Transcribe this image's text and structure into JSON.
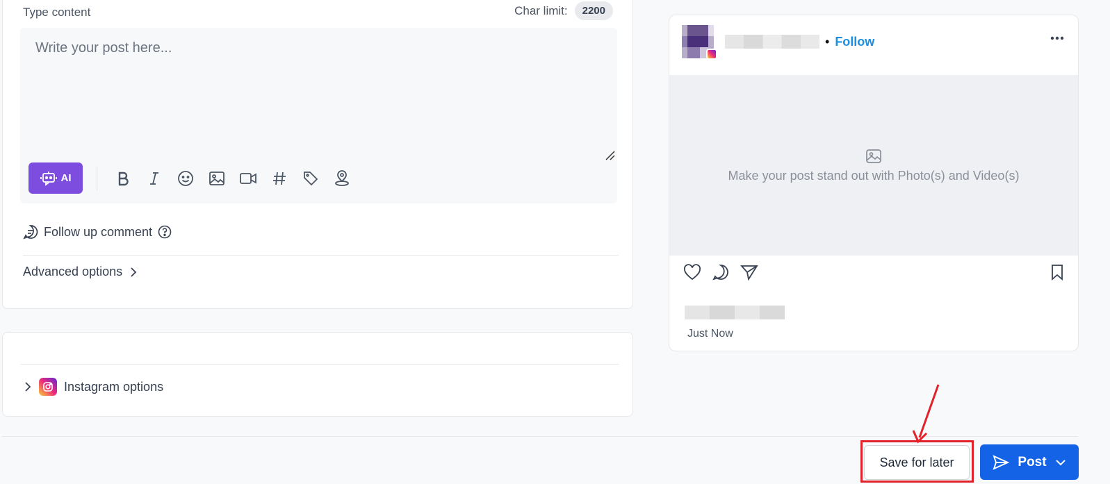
{
  "editor": {
    "type_label": "Type content",
    "char_limit_label": "Char limit:",
    "char_limit_value": "2200",
    "placeholder": "Write your post here...",
    "ai_label": "AI",
    "toolbar_icons": [
      "bold-icon",
      "italic-icon",
      "emoji-icon",
      "image-icon",
      "video-icon",
      "hashtag-icon",
      "tag-icon",
      "location-icon"
    ]
  },
  "follow_up": {
    "label": "Follow up comment"
  },
  "advanced": {
    "label": "Advanced options"
  },
  "instagram_options": {
    "label": "Instagram options"
  },
  "preview": {
    "follow_label": "Follow",
    "media_hint": "Make your post stand out with Photo(s) and Video(s)",
    "time_label": "Just Now"
  },
  "footer": {
    "save_label": "Save for later",
    "post_label": "Post"
  },
  "colors": {
    "ai_purple": "#7c4ddf",
    "post_blue": "#1463e7",
    "follow_blue": "#1d8fe0",
    "highlight_red": "#e2222a"
  }
}
